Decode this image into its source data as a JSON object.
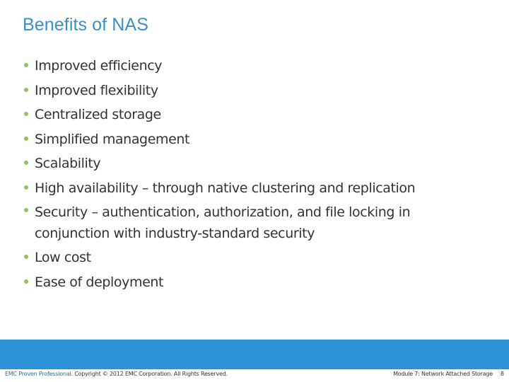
{
  "slide": {
    "title": "Benefits of NAS",
    "bullets": [
      {
        "text": "Improved efficiency"
      },
      {
        "text": "Improved flexibility"
      },
      {
        "text": "Centralized storage"
      },
      {
        "text": "Simplified management"
      },
      {
        "text": "Scalability"
      },
      {
        "text": "High availability – through native clustering and replication"
      },
      {
        "text": "Security – authentication, authorization, and file locking in conjunction with industry-standard security"
      },
      {
        "text": "Low cost"
      },
      {
        "text": "Ease of deployment"
      }
    ]
  },
  "footer": {
    "brand": "EMC Proven Professional.",
    "copyright": " Copyright © 2012 EMC Corporation. All Rights Reserved.",
    "module": "Module 7: Network Attached Storage",
    "page_number": "8"
  },
  "colors": {
    "title": "#3b8fc5",
    "bullet": "#8dc65a",
    "footer_band": "#2e92d8",
    "body_text": "#333333"
  }
}
